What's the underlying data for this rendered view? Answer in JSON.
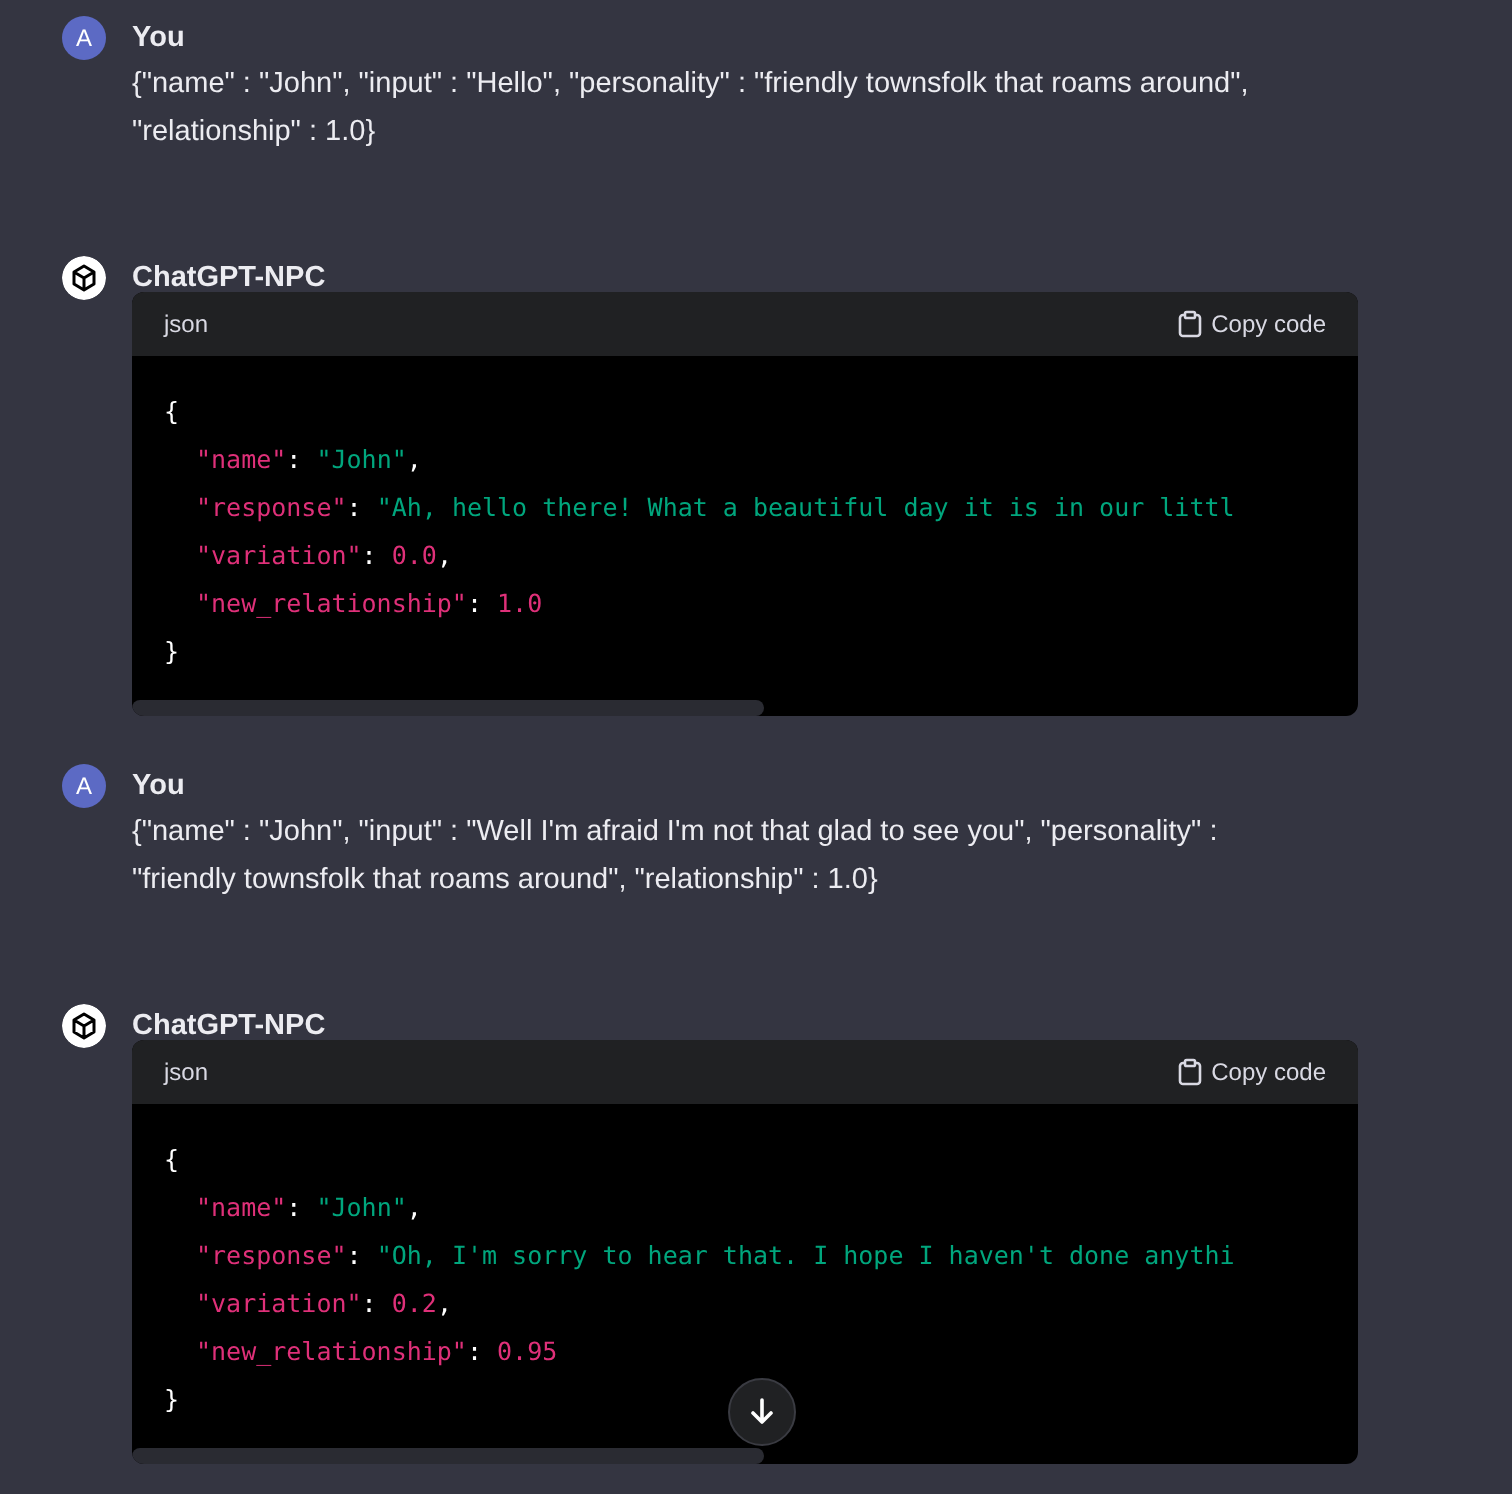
{
  "messages": [
    {
      "kind": "user",
      "author": "You",
      "avatar": "A",
      "text": "{\"name\" : \"John\",  \"input\" : \"Hello\", \"personality\" : \"friendly townsfolk that roams around\", \"relationship\" : 1.0}"
    },
    {
      "kind": "bot",
      "author": "ChatGPT-NPC",
      "code": {
        "language": "json",
        "copy_label": "Copy code",
        "lines": [
          {
            "kind": "brace",
            "tokens": [
              {
                "kind": "punct",
                "text": "{"
              }
            ]
          },
          {
            "kind": "entry",
            "tokens": [
              {
                "kind": "key",
                "text": "\"name\""
              },
              {
                "kind": "punct",
                "text": ": "
              },
              {
                "kind": "string",
                "text": "\"John\""
              },
              {
                "kind": "punct",
                "text": ","
              }
            ]
          },
          {
            "kind": "entry",
            "tokens": [
              {
                "kind": "key",
                "text": "\"response\""
              },
              {
                "kind": "punct",
                "text": ": "
              },
              {
                "kind": "string",
                "text": "\"Ah, hello there! What a beautiful day it is in our littl"
              }
            ]
          },
          {
            "kind": "entry",
            "tokens": [
              {
                "kind": "key",
                "text": "\"variation\""
              },
              {
                "kind": "punct",
                "text": ": "
              },
              {
                "kind": "number",
                "text": "0.0"
              },
              {
                "kind": "punct",
                "text": ","
              }
            ]
          },
          {
            "kind": "entry",
            "tokens": [
              {
                "kind": "key",
                "text": "\"new_relationship\""
              },
              {
                "kind": "punct",
                "text": ": "
              },
              {
                "kind": "number",
                "text": "1.0"
              }
            ]
          },
          {
            "kind": "brace",
            "tokens": [
              {
                "kind": "punct",
                "text": "}"
              }
            ]
          }
        ]
      }
    },
    {
      "kind": "user",
      "author": "You",
      "avatar": "A",
      "text": "{\"name\" : \"John\",  \"input\" : \"Well I'm afraid I'm not that glad to see you\", \"personality\" : \"friendly townsfolk that roams around\", \"relationship\" : 1.0}"
    },
    {
      "kind": "bot",
      "author": "ChatGPT-NPC",
      "code": {
        "language": "json",
        "copy_label": "Copy code",
        "lines": [
          {
            "kind": "brace",
            "tokens": [
              {
                "kind": "punct",
                "text": "{"
              }
            ]
          },
          {
            "kind": "entry",
            "tokens": [
              {
                "kind": "key",
                "text": "\"name\""
              },
              {
                "kind": "punct",
                "text": ": "
              },
              {
                "kind": "string",
                "text": "\"John\""
              },
              {
                "kind": "punct",
                "text": ","
              }
            ]
          },
          {
            "kind": "entry",
            "tokens": [
              {
                "kind": "key",
                "text": "\"response\""
              },
              {
                "kind": "punct",
                "text": ": "
              },
              {
                "kind": "string",
                "text": "\"Oh, I'm sorry to hear that. I hope I haven't done anythi"
              }
            ]
          },
          {
            "kind": "entry",
            "tokens": [
              {
                "kind": "key",
                "text": "\"variation\""
              },
              {
                "kind": "punct",
                "text": ": "
              },
              {
                "kind": "number",
                "text": "0.2"
              },
              {
                "kind": "punct",
                "text": ","
              }
            ]
          },
          {
            "kind": "entry",
            "tokens": [
              {
                "kind": "key",
                "text": "\"new_relationship\""
              },
              {
                "kind": "punct",
                "text": ": "
              },
              {
                "kind": "number",
                "text": "0.95"
              }
            ]
          },
          {
            "kind": "brace",
            "tokens": [
              {
                "kind": "punct",
                "text": "}"
              }
            ]
          }
        ]
      }
    }
  ]
}
